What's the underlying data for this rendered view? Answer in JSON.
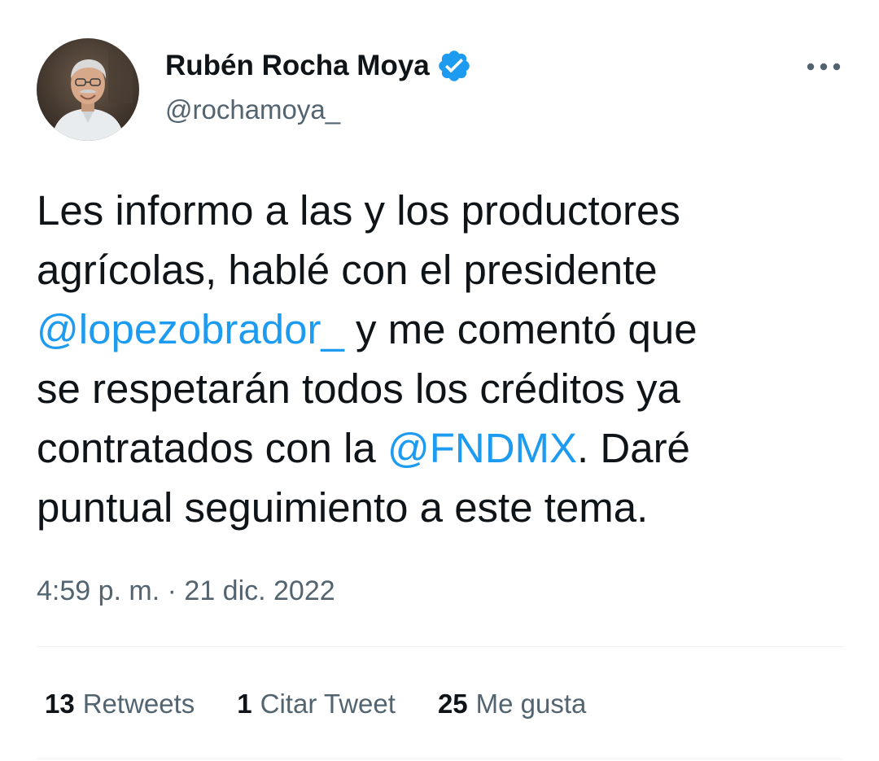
{
  "author": {
    "display_name": "Rubén Rocha Moya",
    "handle": "@rochamoya_",
    "verified": true,
    "avatar_icon": "profile-photo"
  },
  "tweet": {
    "lines": [
      [
        {
          "text": "Les informo a las y los productores",
          "type": "text"
        }
      ],
      [
        {
          "text": "agrícolas, hablé con el presidente",
          "type": "text"
        }
      ],
      [
        {
          "text": "@lopezobrador_",
          "type": "mention"
        },
        {
          "text": " y me comentó que",
          "type": "text"
        }
      ],
      [
        {
          "text": "se respetarán todos los créditos ya",
          "type": "text"
        }
      ],
      [
        {
          "text": "contratados con la ",
          "type": "text"
        },
        {
          "text": "@FNDMX",
          "type": "mention"
        },
        {
          "text": ". Daré",
          "type": "text"
        }
      ],
      [
        {
          "text": "puntual seguimiento a este tema.",
          "type": "text"
        }
      ]
    ],
    "timestamp": "4:59 p. m. · 21 dic. 2022"
  },
  "stats": {
    "retweets": {
      "count": "13",
      "label": "Retweets"
    },
    "quotes": {
      "count": "1",
      "label": "Citar Tweet"
    },
    "likes": {
      "count": "25",
      "label": "Me gusta"
    }
  },
  "icons": {
    "verified": "verified-badge-icon",
    "more": "more-options-icon"
  },
  "colors": {
    "link": "#1d9bf0",
    "text": "#0f1419",
    "secondary": "#536471",
    "divider": "#eff3f4"
  }
}
